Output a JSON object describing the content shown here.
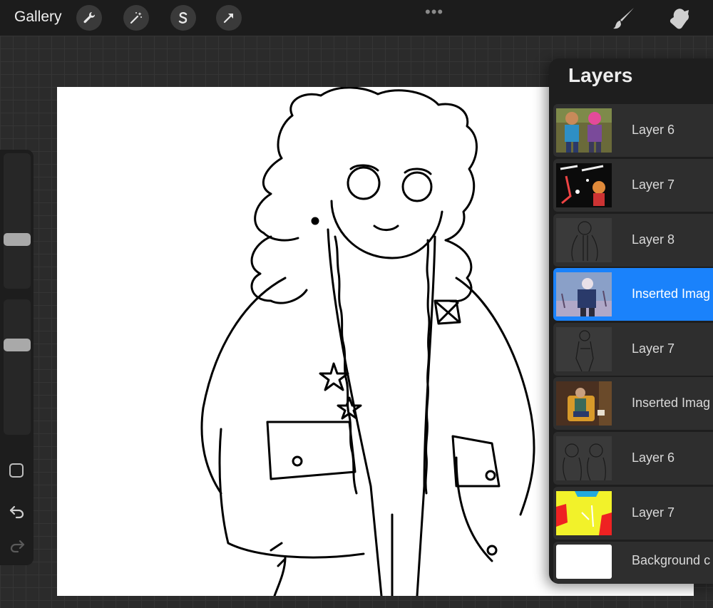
{
  "topbar": {
    "gallery_label": "Gallery",
    "tools": [
      "wrench-icon",
      "magic-wand-icon",
      "selection-s-icon",
      "transform-arrow-icon"
    ],
    "more_dots": "•••",
    "right_tools": [
      "brush-icon",
      "smudge-icon"
    ]
  },
  "sidebar": {
    "brush_size_level": 0.35,
    "opacity_level": 0.68,
    "modifier_button": "square-modifier-icon",
    "undo": "undo-icon",
    "redo": "redo-icon"
  },
  "layers": {
    "title": "Layers",
    "items": [
      {
        "name": "Layer 6",
        "selected": false
      },
      {
        "name": "Layer 7",
        "selected": false
      },
      {
        "name": "Layer 8",
        "selected": false
      },
      {
        "name": "Inserted Imag",
        "selected": true
      },
      {
        "name": "Layer 7",
        "selected": false
      },
      {
        "name": "Inserted Imag",
        "selected": false
      },
      {
        "name": "Layer 6",
        "selected": false
      },
      {
        "name": "Layer 7",
        "selected": false
      },
      {
        "name": "Background c",
        "selected": false
      }
    ]
  },
  "colors": {
    "accent": "#1a82fb",
    "panel": "#1e1e1e",
    "canvas": "#ffffff"
  }
}
